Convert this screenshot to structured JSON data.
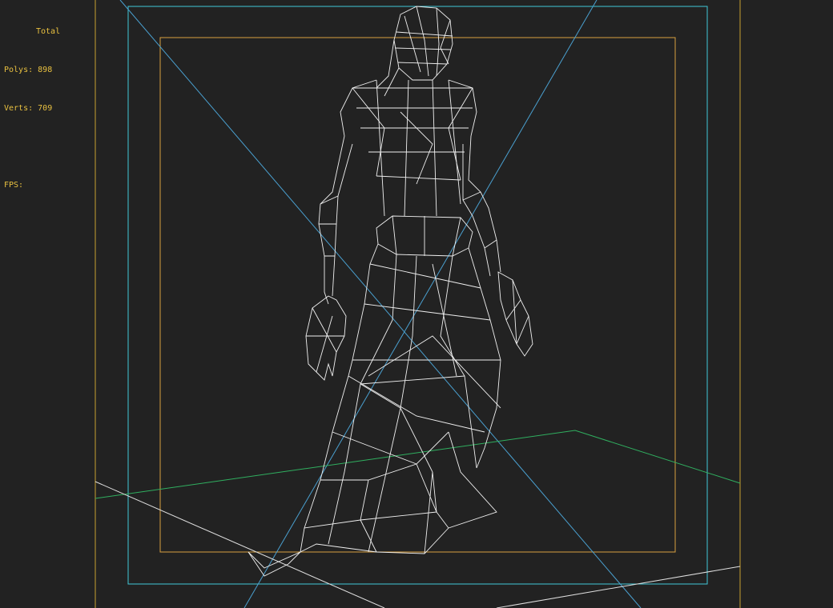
{
  "stats": {
    "title": "Total",
    "polys_label": "Polys:",
    "polys_value": "898",
    "verts_label": "Verts:",
    "verts_value": "709",
    "fps_label": "FPS:"
  },
  "colors": {
    "background": "#222222",
    "stats_text": "#e8c040",
    "outer_frame": "#c8a030",
    "safe_frame_cyan": "#40c8d8",
    "safe_frame_orange": "#d8a040",
    "diagonal_blue": "#4aa0d0",
    "grid_green": "#30b060",
    "grid_white": "#e0e0e0",
    "wireframe": "#f0f0f0"
  }
}
